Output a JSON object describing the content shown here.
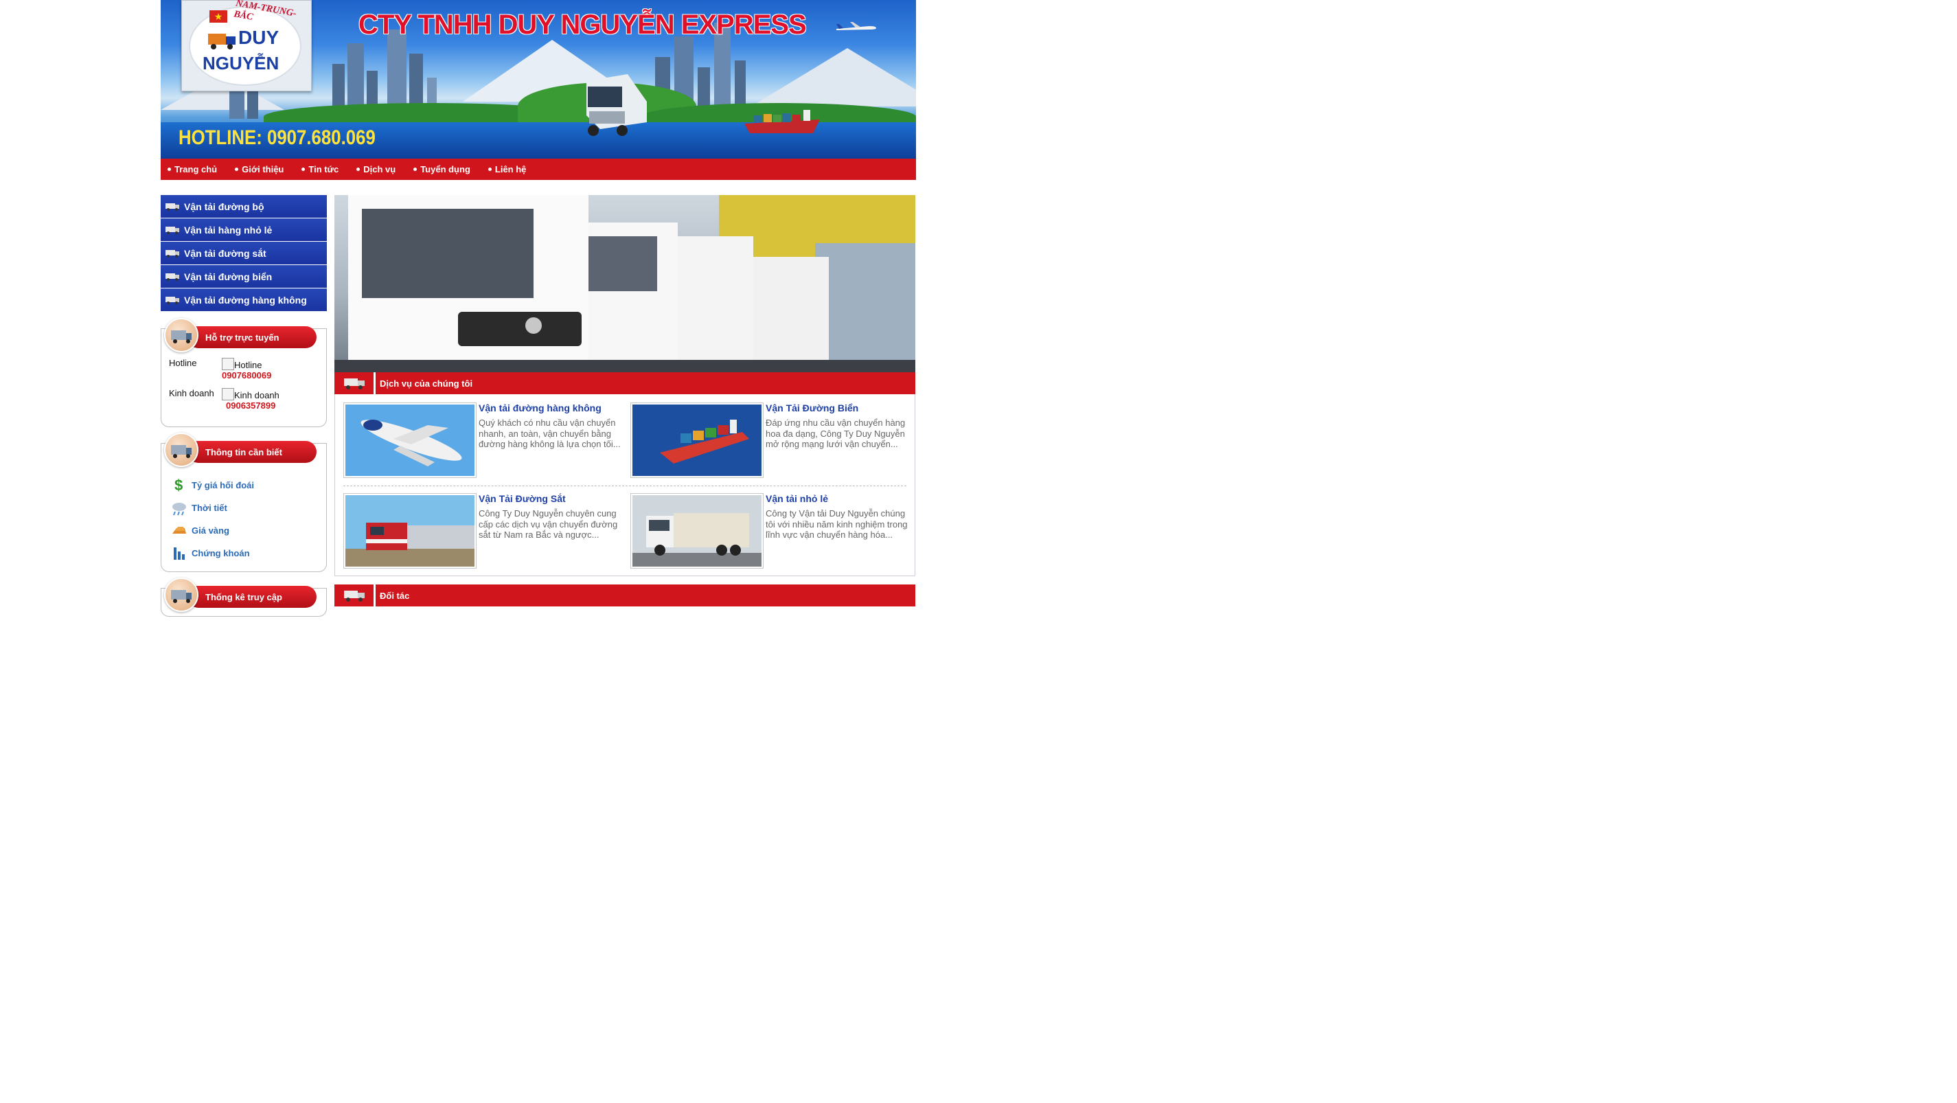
{
  "banner": {
    "company_name": "CTY TNHH DUY NGUYỄN EXPRESS",
    "hotline": "HOTLINE: 0907.680.069",
    "logo_arc": "NAM-TRUNG-BẮC",
    "logo_line1": "DUY",
    "logo_line2": "NGUYỄN"
  },
  "nav": {
    "items": [
      "Trang chủ",
      "Giới thiệu",
      "Tin tức",
      "Dịch vụ",
      "Tuyển dụng",
      "Liên hệ"
    ]
  },
  "sidebar": {
    "categories": [
      "Vận tải đường bộ",
      "Vận tải hàng nhỏ lẻ",
      "Vận tải đường sắt",
      "Vận tải đường biển",
      "Vận tải đường hàng không"
    ],
    "support": {
      "title": "Hỗ trợ trực tuyến",
      "rows": [
        {
          "label": "Hotline",
          "img_alt": "Hotline",
          "number": "0907680069"
        },
        {
          "label": "Kinh doanh",
          "img_alt": "Kinh doanh",
          "number": "0906357899"
        }
      ]
    },
    "info": {
      "title": "Thông tin cần biết",
      "links": [
        "Tỷ giá hối đoái",
        "Thời tiết",
        "Giá vàng",
        "Chứng khoán"
      ]
    },
    "stats": {
      "title": "Thống kê truy cập"
    }
  },
  "main": {
    "services_title": "Dịch vụ của chúng tôi",
    "services": [
      {
        "title": "Vận tải đường hàng không",
        "desc": "Quý khách có nhu cầu vận chuyển nhanh, an toàn, vận chuyển bằng đường hàng không là lựa chọn tối..."
      },
      {
        "title": "Vận Tải Đường Biển",
        "desc": "Đáp ứng nhu cầu vận chuyển hàng hoa đa dạng, Công Ty Duy Nguyễn mở rộng mạng lưới vận chuyển..."
      },
      {
        "title": "Vận Tải Đường Sắt",
        "desc": "Công Ty Duy Nguyễn chuyên cung cấp các dịch vụ vận chuyển đường sắt từ Nam ra Bắc và ngược..."
      },
      {
        "title": "Vận tải nhỏ lẻ",
        "desc": "Công ty Vận tải Duy Nguyễn chúng tôi với nhiều năm kinh nghiệm trong lĩnh vực vận chuyển hàng hóa..."
      }
    ],
    "partners_title": "Đối tác"
  },
  "colors": {
    "brand_red": "#d0161c",
    "brand_blue": "#1d3fa6",
    "link_blue": "#2a6ab8"
  }
}
